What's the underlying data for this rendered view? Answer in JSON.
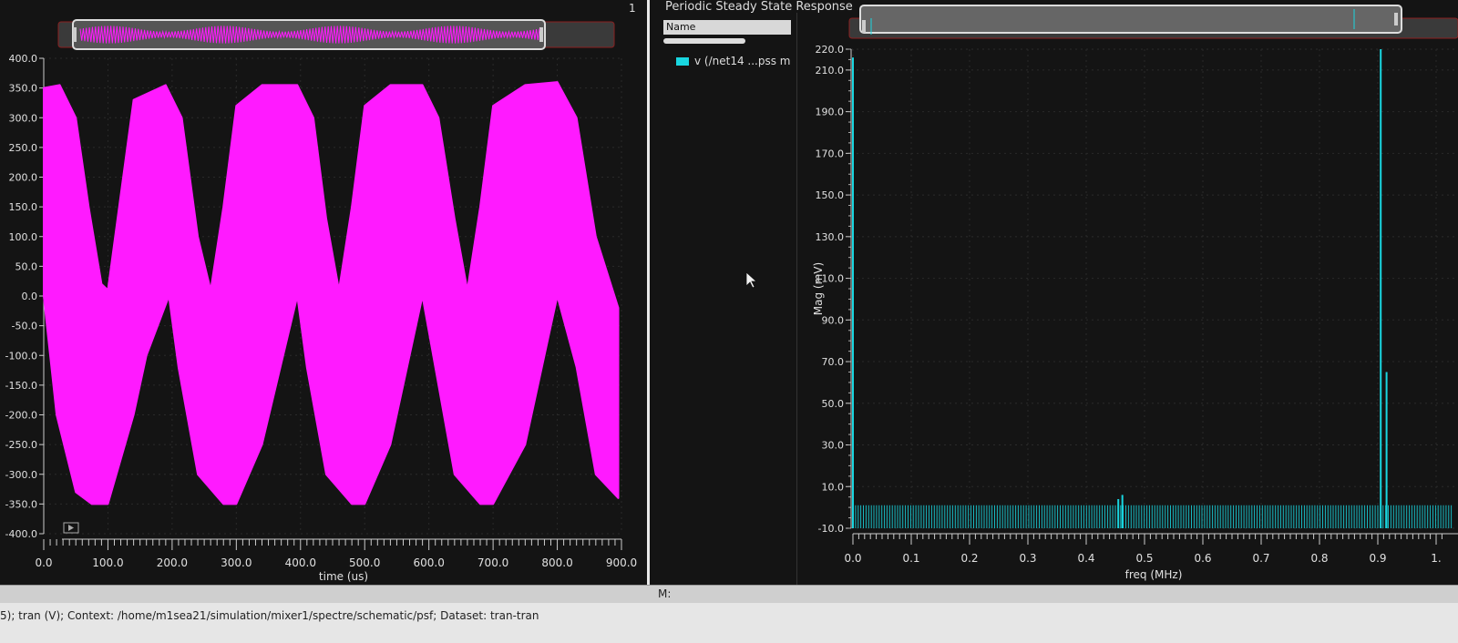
{
  "window": {
    "right_pane_title": "Periodic Steady State Response",
    "left_pane_number": "1",
    "list_header": "Name",
    "legend_label": "v (/net14 ...pss m",
    "middle_bar_label": "M:",
    "status_text": "5); tran (V); Context: /home/m1sea21/simulation/mixer1/spectre/schematic/psf; Dataset: tran-tran"
  },
  "colors": {
    "transient_trace": "#ff1aff",
    "spectrum_trace": "#19d6e0",
    "plot_background": "#141414",
    "axis_text": "#e0e0e0"
  },
  "chart_data": [
    {
      "type": "line",
      "title": "",
      "xlabel": "time (us)",
      "ylabel": "",
      "xlim": [
        0,
        900
      ],
      "ylim": [
        -400,
        400
      ],
      "x_ticks": [
        "0.0",
        "100.0",
        "200.0",
        "300.0",
        "400.0",
        "500.0",
        "600.0",
        "700.0",
        "800.0",
        "900.0"
      ],
      "y_ticks": [
        "400.0",
        "350.0",
        "300.0",
        "250.0",
        "200.0",
        "150.0",
        "100.0",
        "50.0",
        "0.0",
        "-50.0",
        "-100.0",
        "-150.0",
        "-200.0",
        "-250.0",
        "-300.0",
        "-350.0",
        "-400.0"
      ],
      "series": [
        {
          "upper_envelope_x": [
            0,
            25,
            50,
            70,
            90,
            100,
            140,
            190,
            215,
            240,
            260,
            280,
            300,
            340,
            395,
            420,
            440,
            460,
            480,
            500,
            540,
            590,
            615,
            640,
            660,
            680,
            700,
            750,
            800,
            830,
            860,
            895
          ],
          "upper_envelope_y": [
            350,
            355,
            300,
            150,
            20,
            10,
            330,
            355,
            300,
            100,
            10,
            150,
            320,
            355,
            355,
            300,
            130,
            10,
            150,
            320,
            355,
            355,
            300,
            130,
            10,
            150,
            320,
            355,
            360,
            300,
            100,
            -20
          ],
          "lower_envelope_x": [
            0,
            20,
            50,
            75,
            100,
            140,
            160,
            195,
            210,
            240,
            280,
            300,
            340,
            395,
            410,
            440,
            480,
            500,
            540,
            590,
            610,
            640,
            680,
            700,
            750,
            800,
            830,
            860,
            895
          ],
          "lower_envelope_y": [
            0,
            -200,
            -330,
            -350,
            -350,
            -200,
            -100,
            0,
            -120,
            -300,
            -350,
            -350,
            -250,
            0,
            -120,
            -300,
            -350,
            -350,
            -250,
            0,
            -120,
            -300,
            -350,
            -350,
            -250,
            0,
            -120,
            -300,
            -340
          ]
        }
      ],
      "grid": true
    },
    {
      "type": "line",
      "title": "",
      "xlabel": "freq (MHz)",
      "ylabel": "Mag (mV)",
      "xlim": [
        0,
        1.0
      ],
      "ylim": [
        -10,
        220
      ],
      "x_ticks": [
        "0.0",
        "0.1",
        "0.2",
        "0.3",
        "0.4",
        "0.5",
        "0.6",
        "0.7",
        "0.8",
        "0.9",
        "1."
      ],
      "y_ticks": [
        "220.0",
        "210.0",
        "190.0",
        "170.0",
        "150.0",
        "130.0",
        "110.0",
        "90.0",
        "70.0",
        "50.0",
        "30.0",
        "10.0",
        "-10.0"
      ],
      "series": [
        {
          "peaks_x": [
            0.0,
            0.455,
            0.462,
            0.905,
            0.915
          ],
          "peaks_y": [
            216,
            4,
            6,
            220,
            65
          ],
          "noise_floor": 1
        }
      ],
      "grid": true
    }
  ]
}
